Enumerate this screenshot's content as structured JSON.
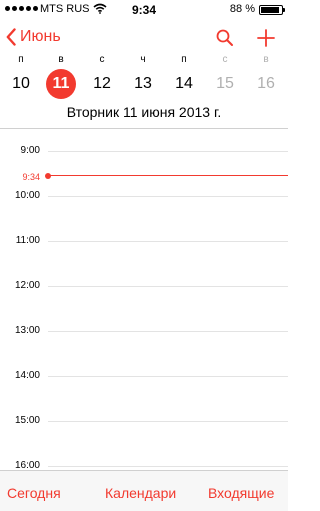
{
  "status_bar": {
    "carrier": "MTS RUS",
    "time": "9:34",
    "battery_percent": "88 %",
    "battery_level": 0.88
  },
  "nav": {
    "back_label": "Июнь",
    "accent_color": "#f23a2f"
  },
  "week": {
    "days": [
      {
        "weekday": "п",
        "date": "10"
      },
      {
        "weekday": "в",
        "date": "11"
      },
      {
        "weekday": "с",
        "date": "12"
      },
      {
        "weekday": "ч",
        "date": "13"
      },
      {
        "weekday": "п",
        "date": "14"
      },
      {
        "weekday": "с",
        "date": "15"
      },
      {
        "weekday": "в",
        "date": "16"
      }
    ],
    "selected_index": 1
  },
  "date_title": "Вторник  11 июня 2013 г.",
  "timeline": {
    "hours": [
      "9:00",
      "10:00",
      "11:00",
      "12:00",
      "13:00",
      "14:00",
      "15:00",
      "16:00"
    ],
    "current_time": "9:34"
  },
  "tabbar": {
    "today": "Сегодня",
    "calendars": "Календари",
    "inbox": "Входящие"
  }
}
